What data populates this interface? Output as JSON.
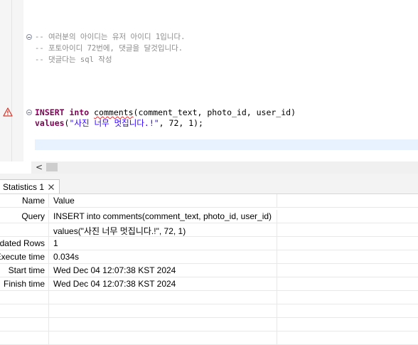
{
  "editor": {
    "comments": [
      "-- 여러분의 아이디는 유저 아이디 1입니다.",
      "-- 포토아이디 72번에, 댓글을 달것입니다.",
      "-- 댓글다는 sql 작성"
    ],
    "statement": {
      "kw_insert": "INSERT",
      "kw_into": "into",
      "table": "comments",
      "columns": "(comment_text, photo_id, user_id)",
      "kw_values": "values",
      "open_paren": "(",
      "string_value": "\"사진 너무 멋집니다.!\"",
      "rest": ", 72, 1);"
    },
    "warning_icon": "warning-triangle-icon",
    "fold_icon": "fold-collapse-icon",
    "scroll_left_arrow": "<"
  },
  "results": {
    "tab_label": "Statistics 1",
    "tab_close_icon": "close-icon",
    "columns": {
      "name": "Name",
      "value": "Value"
    },
    "rows": [
      {
        "name": "Query",
        "value": "INSERT into comments(comment_text, photo_id, user_id)"
      },
      {
        "name": "",
        "value": "values(\"사진 너무 멋집니다.!\", 72, 1)"
      },
      {
        "name": "Updated Rows",
        "value": "1"
      },
      {
        "name": "Execute time",
        "value": "0.034s"
      },
      {
        "name": "Start time",
        "value": "Wed Dec 04 12:07:38 KST 2024"
      },
      {
        "name": "Finish time",
        "value": "Wed Dec 04 12:07:38 KST 2024"
      }
    ]
  },
  "colors": {
    "keyword": "#7f0055",
    "string": "#2a00ff",
    "comment": "#8c8c8c",
    "current_line": "#e8f2fe",
    "error_squiggle": "#e03030"
  }
}
